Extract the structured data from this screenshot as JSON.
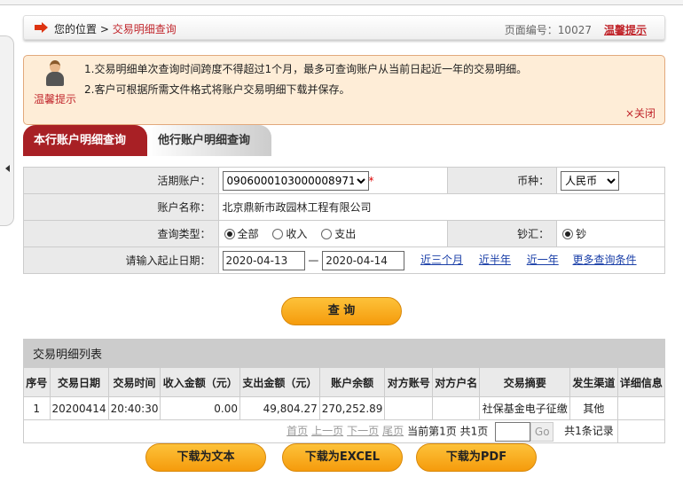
{
  "breadcrumb": {
    "prefix": "您的位置 >",
    "current": "交易明细查询",
    "page_no": "页面编号：10027",
    "tip_link": "温馨提示"
  },
  "notice": {
    "label": "温馨提示",
    "line1": "1.交易明细单次查询时间跨度不得超过1个月，最多可查询账户从当前日起近一年的交易明细。",
    "line2": "2.客户可根据所需文件格式将账户交易明细下载并保存。",
    "close": "×关闭"
  },
  "tabs": [
    {
      "label": "本行账户明细查询",
      "active": true
    },
    {
      "label": "他行账户明细查询",
      "active": false
    }
  ],
  "form": {
    "account_label": "活期账户：",
    "account_value": "0906000103000008971",
    "required": "*",
    "currency_label": "币种：",
    "currency_value": "人民币",
    "name_label": "账户名称：",
    "name_value": "北京鼎新市政园林工程有限公司",
    "type_label": "查询类型：",
    "type_options": [
      "全部",
      "收入",
      "支出"
    ],
    "cash_label": "钞汇：",
    "cash_value": "钞",
    "date_label": "请输入起止日期：",
    "date_from": "2020-04-13",
    "date_sep": "—",
    "date_to": "2020-04-14",
    "quick_links": [
      "近三个月",
      "近半年",
      "近一年",
      "更多查询条件"
    ]
  },
  "query_button": "查 询",
  "list": {
    "title": "交易明细列表",
    "columns": [
      "序号",
      "交易日期",
      "交易时间",
      "收入金额（元）",
      "支出金额（元）",
      "账户余额",
      "对方账号",
      "对方户名",
      "交易摘要",
      "发生渠道",
      "详细信息"
    ],
    "rows": [
      [
        "1",
        "20200414",
        "20:40:30",
        "0.00",
        "49,804.27",
        "270,252.89",
        "",
        "",
        "社保基金电子征缴",
        "其他",
        ""
      ]
    ],
    "pager": {
      "first": "首页",
      "prev": "上一页",
      "next": "下一页",
      "last": "尾页",
      "current": "当前第1页 共1页",
      "go": "Go",
      "total": "共1条记录"
    }
  },
  "downloads": [
    "下载为文本",
    "下载为EXCEL",
    "下载为PDF"
  ]
}
